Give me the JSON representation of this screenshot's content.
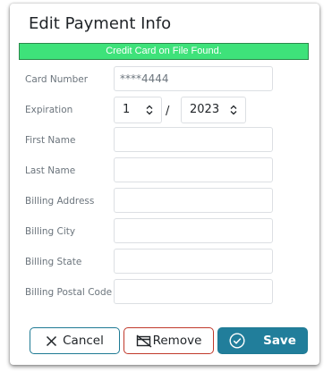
{
  "dialog": {
    "title": "Edit Payment Info",
    "banner": "Credit Card on File Found."
  },
  "form": {
    "card_number": {
      "label": "Card Number",
      "value": "****4444"
    },
    "expiration": {
      "label": "Expiration",
      "month": "1",
      "separator": "/",
      "year": "2023"
    },
    "first_name": {
      "label": "First Name",
      "value": ""
    },
    "last_name": {
      "label": "Last Name",
      "value": ""
    },
    "billing_address": {
      "label": "Billing Address",
      "value": ""
    },
    "billing_city": {
      "label": "Billing City",
      "value": ""
    },
    "billing_state": {
      "label": "Billing State",
      "value": ""
    },
    "billing_postal_code": {
      "label": "Billing Postal Code",
      "value": ""
    }
  },
  "actions": {
    "cancel": {
      "label": "Cancel",
      "icon": "x-icon"
    },
    "remove": {
      "label": "Remove",
      "icon": "card-remove-icon"
    },
    "save": {
      "label": "Save",
      "icon": "check-circle-icon"
    }
  },
  "colors": {
    "banner": "#3ee27a",
    "primary": "#217e9b",
    "danger": "#c0392b"
  }
}
